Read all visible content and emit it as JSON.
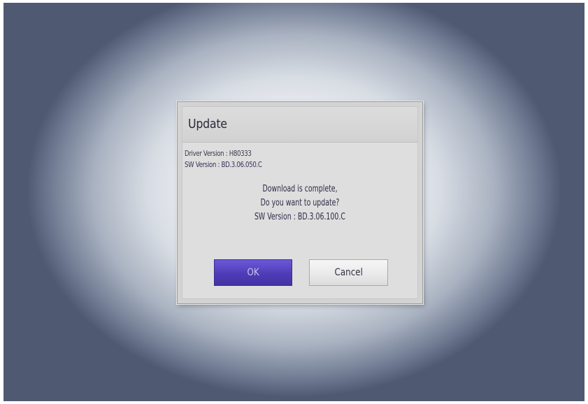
{
  "dialog": {
    "title": "Update",
    "driver_version": "Driver Version : H80333",
    "sw_version": "SW Version : BD.3.06.050.C",
    "message": {
      "line1": "Download is complete,",
      "line2": "Do you want to update?",
      "line3": "SW Version : BD.3.06.100.C"
    },
    "buttons": {
      "ok": "OK",
      "cancel": "Cancel"
    }
  },
  "colors": {
    "ok_button": "#5544c4",
    "cancel_button": "#eeeeee",
    "dialog_bg": "#dedede",
    "text": "#2c2c48"
  }
}
